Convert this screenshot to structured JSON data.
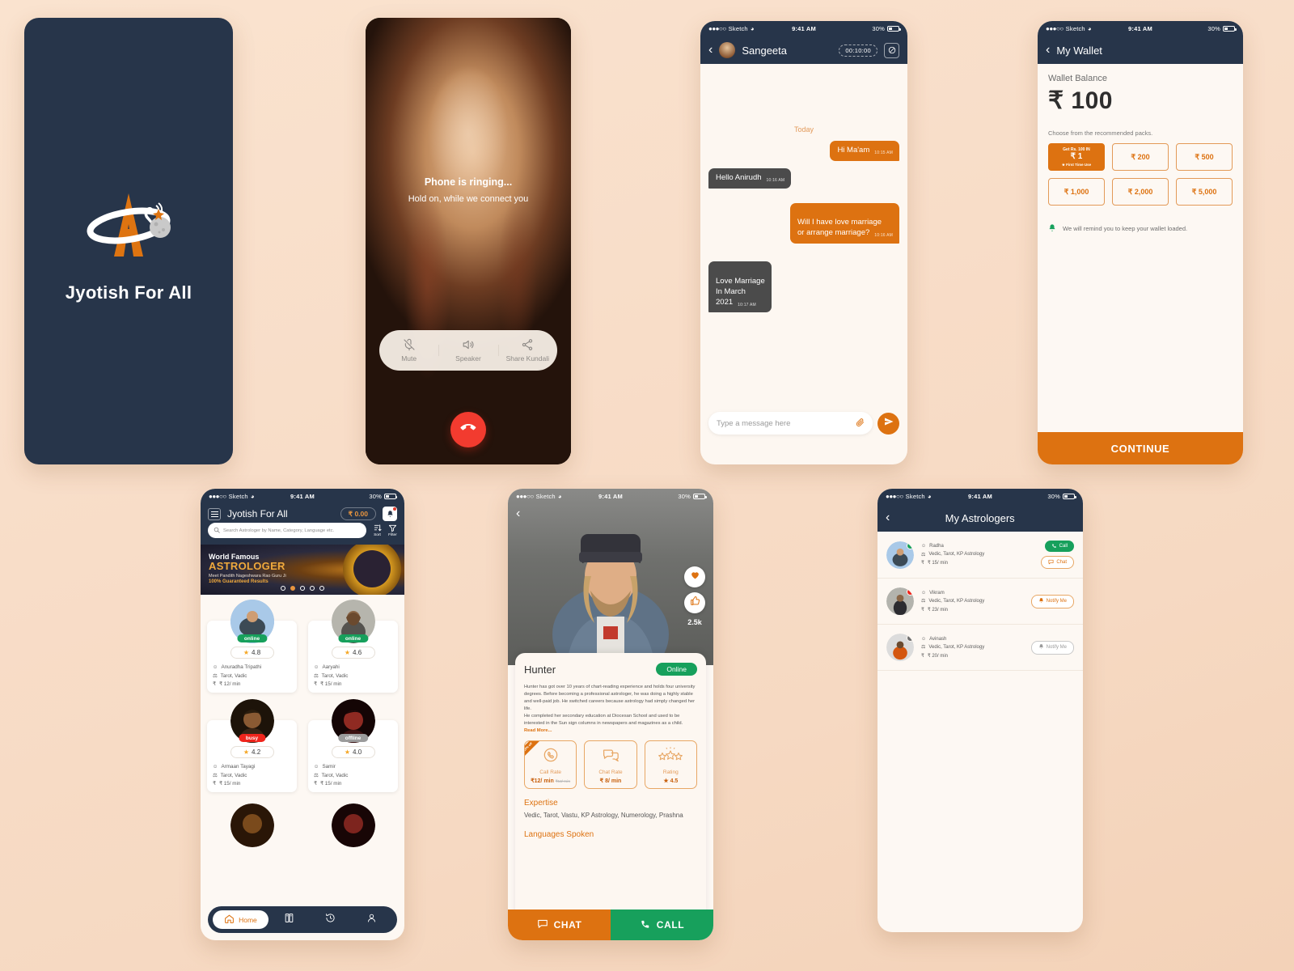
{
  "status_bar": {
    "carrier": "Sketch",
    "time": "9:41 AM",
    "battery": "30%"
  },
  "splash": {
    "app_name": "Jyotish For All",
    "bg_color": "#27354a",
    "accent": "#dd7211"
  },
  "call_screen": {
    "ringing_title": "Phone is ringing...",
    "ringing_sub": "Hold on, while we connect you",
    "actions": [
      {
        "label": "Mute",
        "icon": "mic-off-icon"
      },
      {
        "label": "Speaker",
        "icon": "speaker-icon"
      },
      {
        "label": "Share Kundali",
        "icon": "share-icon"
      }
    ],
    "hangup_icon": "hangup-icon"
  },
  "chat_screen": {
    "contact_name": "Sangeeta",
    "timer": "00:10:00",
    "day_separator": "Today",
    "messages": [
      {
        "text": "Hi Ma'am",
        "time": "10:15 AM",
        "side": "out"
      },
      {
        "text": "Hello Anirudh",
        "time": "10:16 AM",
        "side": "in"
      },
      {
        "text": "Will I have love marriage\nor arrange marriage?",
        "time": "10:16 AM",
        "side": "out"
      },
      {
        "text": "Love Marriage\nIn March\n2021",
        "time": "10:17 AM",
        "side": "in"
      }
    ],
    "input_placeholder": "Type a message here",
    "attach_icon": "paperclip-icon",
    "send_icon": "send-icon"
  },
  "wallet_screen": {
    "title": "My Wallet",
    "balance_label": "Wallet Balance",
    "balance_amount": "₹ 100",
    "packs_label": "Choose from the recommended packs.",
    "packs": [
      {
        "top": "Get Rs. 100 IN",
        "amount": "₹ 1",
        "bottom": "★ First Time Use",
        "highlight": true
      },
      {
        "amount": "₹ 200",
        "highlight": false
      },
      {
        "amount": "₹ 500",
        "highlight": false
      },
      {
        "amount": "₹ 1,000",
        "highlight": false
      },
      {
        "amount": "₹ 2,000",
        "highlight": false
      },
      {
        "amount": "₹ 5,000",
        "highlight": false
      }
    ],
    "reminder_note": "We will remind you to keep your wallet loaded.",
    "reminder_icon": "bell-icon",
    "continue_label": "CONTINUE"
  },
  "home_screen": {
    "title": "Jyotish For All",
    "balance": "₹ 0.00",
    "menu_icon": "hamburger-icon",
    "bell_icon": "bell-icon",
    "search_placeholder": "Search Astrologer by Name, Category, Language etc.",
    "sort_label": "Sort",
    "filter_label": "Filter",
    "banner": {
      "line1": "World Famous",
      "line2": "ASTROLOGER",
      "line3": "Meet Pandith Nageshwara Rao Guru Ji",
      "line4": "100% Guaranteed Results",
      "dot_count": 5,
      "active_dot": 2
    },
    "astrologers": [
      {
        "name": "Anuradha Tripathi",
        "status": "online",
        "rating": "4.8",
        "skills": "Tarot, Vadic",
        "price": "₹ 12/ min"
      },
      {
        "name": "Aaryahi",
        "status": "online",
        "rating": "4.6",
        "skills": "Tarot, Vadic",
        "price": "₹ 15/ min"
      },
      {
        "name": "Armaan Tayagi",
        "status": "busy",
        "rating": "4.2",
        "skills": "Tarot, Vadic",
        "price": "₹ 15/ min"
      },
      {
        "name": "Samir",
        "status": "offline",
        "rating": "4.0",
        "skills": "Tarot, Vadic",
        "price": "₹ 15/ min"
      }
    ],
    "nav": [
      {
        "label": "Home",
        "icon": "home-icon",
        "active": true
      },
      {
        "label": "",
        "icon": "book-icon",
        "active": false
      },
      {
        "label": "",
        "icon": "history-icon",
        "active": false
      },
      {
        "label": "",
        "icon": "profile-icon",
        "active": false
      }
    ]
  },
  "profile_screen": {
    "name": "Hunter",
    "status": "Online",
    "likes": "2.5k",
    "heart_icon": "heart-icon",
    "thumb_icon": "thumbs-up-icon",
    "bio": "Hunter has got over 10 years of chart-reading experience and holds four university degrees. Before becoming a professional astrologer, he was doing a highly stable and well-paid job. He switched careers because astrology had simply changed her life.\nHe completed her secondary education at Diocesan School and used to be interested in the Sun sign columns in newspapers and magazines as a child.",
    "read_more": "Read More...",
    "rates": [
      {
        "label": "Call Rate",
        "value": "₹12/ min",
        "strike": "₹14/ min",
        "ribbon": "10% off",
        "icon": "phone-icon"
      },
      {
        "label": "Chat Rate",
        "value": "₹ 8/ min",
        "icon": "chat-icon"
      },
      {
        "label": "Rating",
        "value": "★ 4.5",
        "icon": "stars-icon"
      }
    ],
    "expertise_title": "Expertise",
    "expertise_body": "Vedic, Tarot, Vastu, KP Astrology, Numerology, Prashna",
    "languages_title": "Languages Spoken",
    "chat_button": "CHAT",
    "call_button": "CALL"
  },
  "my_astrologers_screen": {
    "title": "My Astrologers",
    "rows": [
      {
        "name": "Radha",
        "skills": "Vedic, Tarot, KP Astrology",
        "price": "₹  15/ min",
        "status": "online",
        "buttons": [
          {
            "label": "Call",
            "type": "call",
            "icon": "phone-icon"
          },
          {
            "label": "Chat",
            "type": "chat",
            "icon": "chat-icon"
          }
        ]
      },
      {
        "name": "Vikram",
        "skills": "Vedic, Tarot, KP Astrology",
        "price": "₹  23/ min",
        "status": "busy",
        "buttons": [
          {
            "label": "Notify Me",
            "type": "notify",
            "icon": "bell-icon"
          }
        ]
      },
      {
        "name": "Avinash",
        "skills": "Vedic, Tarot, KP Astrology",
        "price": "₹  20/ min",
        "status": "offline",
        "buttons": [
          {
            "label": "Notify Me",
            "type": "notify-dim",
            "icon": "bell-icon"
          }
        ]
      }
    ]
  }
}
